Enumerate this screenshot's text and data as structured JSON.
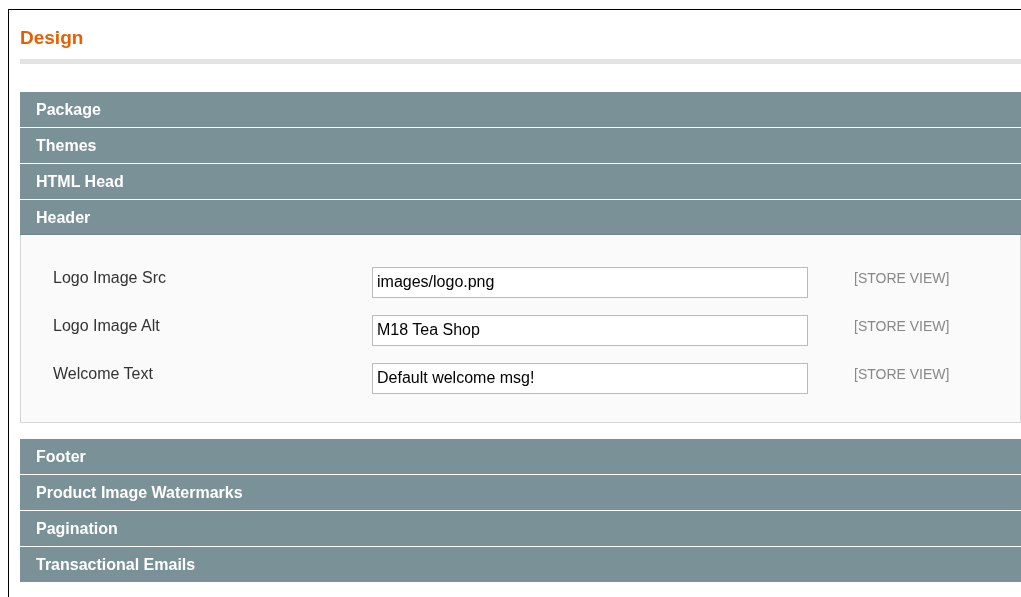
{
  "title": "Design",
  "sections": [
    {
      "label": "Package",
      "expanded": false
    },
    {
      "label": "Themes",
      "expanded": false
    },
    {
      "label": "HTML Head",
      "expanded": false
    },
    {
      "label": "Header",
      "expanded": true,
      "fields": [
        {
          "label": "Logo Image Src",
          "value": "images/logo.png",
          "scope": "[STORE VIEW]"
        },
        {
          "label": "Logo Image Alt",
          "value": "M18 Tea Shop",
          "scope": "[STORE VIEW]"
        },
        {
          "label": "Welcome Text",
          "value": "Default welcome msg!",
          "scope": "[STORE VIEW]"
        }
      ]
    },
    {
      "label": "Footer",
      "expanded": false
    },
    {
      "label": "Product Image Watermarks",
      "expanded": false
    },
    {
      "label": "Pagination",
      "expanded": false
    },
    {
      "label": "Transactional Emails",
      "expanded": false
    }
  ]
}
